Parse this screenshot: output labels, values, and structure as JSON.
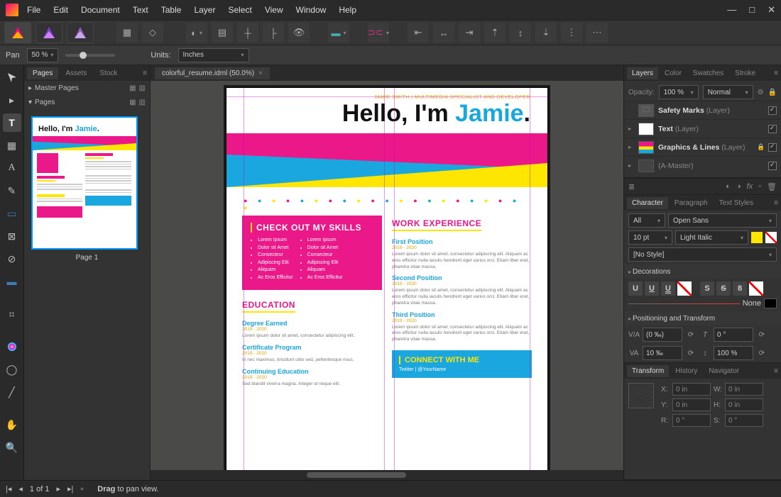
{
  "menu": [
    "File",
    "Edit",
    "Document",
    "Text",
    "Table",
    "Layer",
    "Select",
    "View",
    "Window",
    "Help"
  ],
  "context": {
    "pan_label": "Pan",
    "zoom": "50 %",
    "units_label": "Units:",
    "units_value": "Inches"
  },
  "pages_panel": {
    "tabs": [
      "Pages",
      "Assets",
      "Stock"
    ],
    "master_label": "Master Pages",
    "pages_label": "Pages",
    "page1_label": "Page 1"
  },
  "doc_tab": "colorful_resume.idml (50.0%)",
  "resume": {
    "subtitle": "JAMIE SMITH | MULTIMEDIA SPECIALIST AND DEVELOPER",
    "hello_a": "Hello, I'm ",
    "hello_b": "Jamie",
    "hello_c": ".",
    "skills_h": "CHECK OUT MY SKILLS",
    "skills": [
      "Lorem Ipsum",
      "Dolor sit Amet",
      "Consecteur",
      "Adipiscing Elit",
      "Aliquam",
      "Ac Eros Efficitur"
    ],
    "edu_h": "EDUCATION",
    "edu1": "Degree Earned",
    "edu2": "Certificate Program",
    "edu3": "Continuing Education",
    "work_h": "WORK EXPERIENCE",
    "work1": "First Position",
    "work2": "Second Position",
    "work3": "Third Position",
    "daterange": "2019 - 2020",
    "long_body": "Lorem ipsum dolor sit amet, consectetur adipiscing elit. Aliquam ac eros efficitur nulla iaculis hendrerit eget varius orci. Etiam liber erat, pharetra vitae massa.",
    "edu_body1": "Lorem ipsum dolor sit amet, consectetur adipiscing elit.",
    "edu_body2": "In nec maximus, tincidunt odio sed, pellentesque risus.",
    "edu_body3": "Sed blandit viverra magna. Integer id neque elit.",
    "connect_h": "CONNECT WITH ME",
    "connect1": "Twitter | @YourName"
  },
  "layers_panel": {
    "tabs": [
      "Layers",
      "Color",
      "Swatches",
      "Stroke"
    ],
    "opacity_label": "Opacity:",
    "opacity": "100 %",
    "blend": "Normal",
    "layers": [
      {
        "name": "Safety Marks",
        "suffix": "(Layer)",
        "type": "folder",
        "checked": true,
        "lock": false
      },
      {
        "name": "Text",
        "suffix": "(Layer)",
        "type": "thumb",
        "checked": true,
        "lock": false
      },
      {
        "name": "Graphics & Lines",
        "suffix": "(Layer)",
        "type": "thumb",
        "checked": true,
        "lock": true
      },
      {
        "name": "(A-Master)",
        "suffix": "",
        "type": "blank",
        "checked": true,
        "lock": false
      }
    ]
  },
  "char_panel": {
    "tabs": [
      "Character",
      "Paragraph",
      "Text Styles"
    ],
    "collection": "All",
    "font": "Open Sans",
    "size": "10 pt",
    "style": "Light Italic",
    "no_style": "[No Style]",
    "deco_h": "Decorations",
    "none_label": "None",
    "pos_h": "Positioning and Transform",
    "kern": "(0 ‰)",
    "track": "10 ‰",
    "rot": "0 °",
    "hscale": "100 %"
  },
  "transform_panel": {
    "tabs": [
      "Transform",
      "History",
      "Navigator"
    ],
    "x": "0 in",
    "y": "0 in",
    "w": "0 in",
    "h": "0 in",
    "r": "0 °",
    "s": "0 °"
  },
  "statusbar": {
    "page_info": "1 of 1",
    "hint_strong": "Drag",
    "hint_rest": " to pan view."
  }
}
